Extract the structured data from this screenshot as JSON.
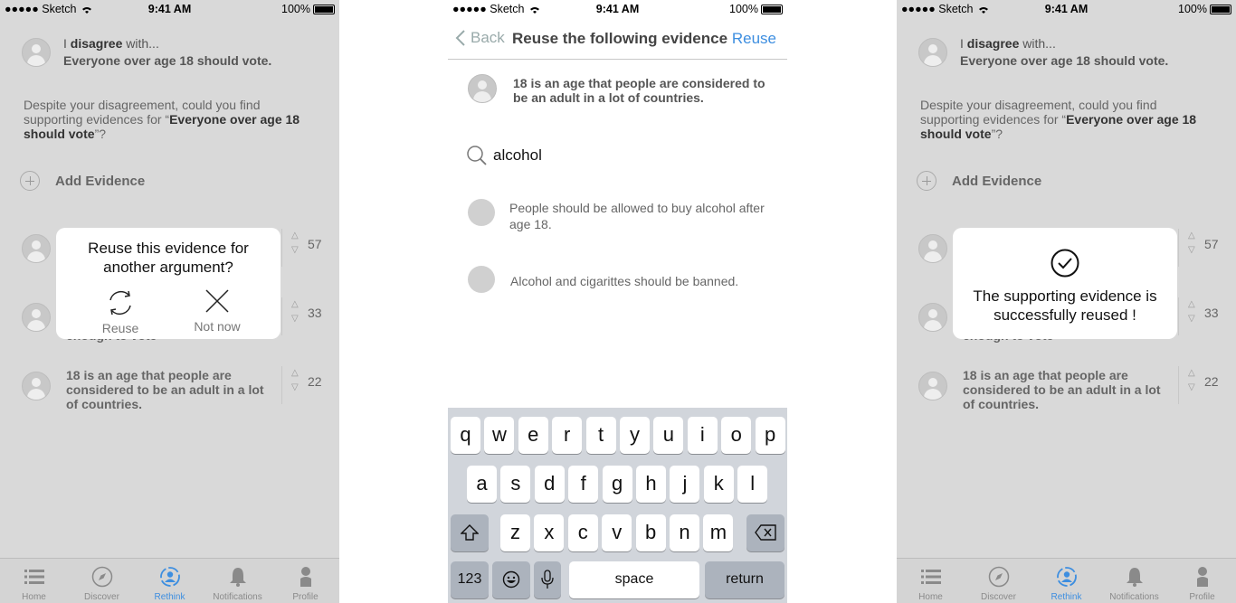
{
  "status": {
    "carrier": "Sketch",
    "time": "9:41 AM",
    "battery": "100%"
  },
  "left": {
    "claim": {
      "prefix": "I",
      "verb": "disagree",
      "suffix": "with...",
      "statement": "Everyone over age 18 should vote."
    },
    "prompt": {
      "before": "Despite your disagreement, could you find supporting evidences for “",
      "bold": "Everyone over age 18 should vote",
      "after": "”?"
    },
    "add_evidence": "Add Evidence",
    "evidence": [
      {
        "text": "",
        "votes": "57"
      },
      {
        "text": "enough to vote",
        "votes": "33"
      },
      {
        "text": "18 is an age that people are considered to be an adult in a lot of countries.",
        "votes": "22"
      }
    ],
    "popup": {
      "title": "Reuse this evidence for another argument?",
      "reuse": "Reuse",
      "not_now": "Not now"
    }
  },
  "middle": {
    "nav": {
      "back": "Back",
      "title": "Reuse the following evidence",
      "action": "Reuse"
    },
    "quoted": "18 is an age that people are considered to be an adult in a lot of countries.",
    "search": {
      "value": "alcohol"
    },
    "results": [
      "People should be allowed to buy alcohol after age 18.",
      "Alcohol and cigarittes should be banned."
    ],
    "keyboard": {
      "row1": [
        "q",
        "w",
        "e",
        "r",
        "t",
        "y",
        "u",
        "i",
        "o",
        "p"
      ],
      "row2": [
        "a",
        "s",
        "d",
        "f",
        "g",
        "h",
        "j",
        "k",
        "l"
      ],
      "row3": [
        "z",
        "x",
        "c",
        "v",
        "b",
        "n",
        "m"
      ],
      "numbers": "123",
      "space": "space",
      "return": "return"
    }
  },
  "right": {
    "claim": {
      "prefix": "I",
      "verb": "disagree",
      "suffix": "with...",
      "statement": "Everyone over age 18 should vote."
    },
    "prompt": {
      "before": "Despite your disagreement, could you find supporting evidences for “",
      "bold": "Everyone over age 18 should vote",
      "after": "”?"
    },
    "add_evidence": "Add Evidence",
    "evidence": [
      {
        "text": "",
        "votes": "57"
      },
      {
        "text": "enough to vote",
        "votes": "33"
      },
      {
        "text": "18 is an age that people are considered to be an adult in a lot of countries.",
        "votes": "22"
      }
    ],
    "success": "The supporting evidence is successfully reused !"
  },
  "tabs": [
    {
      "label": "Home",
      "icon": "list-icon"
    },
    {
      "label": "Discover",
      "icon": "compass-icon"
    },
    {
      "label": "Rethink",
      "icon": "rethink-icon",
      "active": true
    },
    {
      "label": "Notifications",
      "icon": "bell-icon"
    },
    {
      "label": "Profile",
      "icon": "person-icon"
    }
  ],
  "colors": {
    "accent": "#3d8ee0",
    "overlay": "#d9d9d9"
  }
}
